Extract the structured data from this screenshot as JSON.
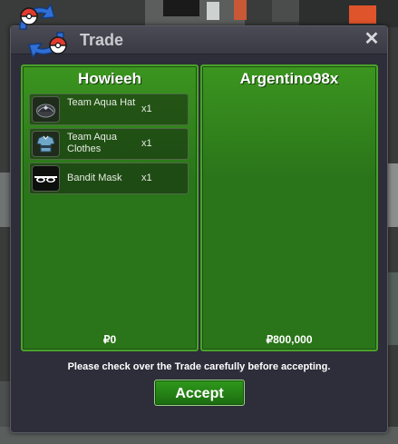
{
  "window": {
    "title": "Trade",
    "close_label": "✕"
  },
  "left": {
    "name": "Howieeh",
    "money": "₽0",
    "items": [
      {
        "name": "Team Aqua Hat",
        "qty": "x1",
        "icon": "hat-icon"
      },
      {
        "name": "Team Aqua Clothes",
        "qty": "x1",
        "icon": "clothes-icon"
      },
      {
        "name": "Bandit Mask",
        "qty": "x1",
        "icon": "mask-icon"
      }
    ]
  },
  "right": {
    "name": "Argentino98x",
    "money": "₽800,000",
    "items": []
  },
  "footer": {
    "notice": "Please check over the Trade carefully before accepting.",
    "accept_label": "Accept"
  },
  "colors": {
    "panel_green": "#2a741a",
    "accept_green": "#2f9a1b",
    "window_bg": "#2e2d3a"
  }
}
